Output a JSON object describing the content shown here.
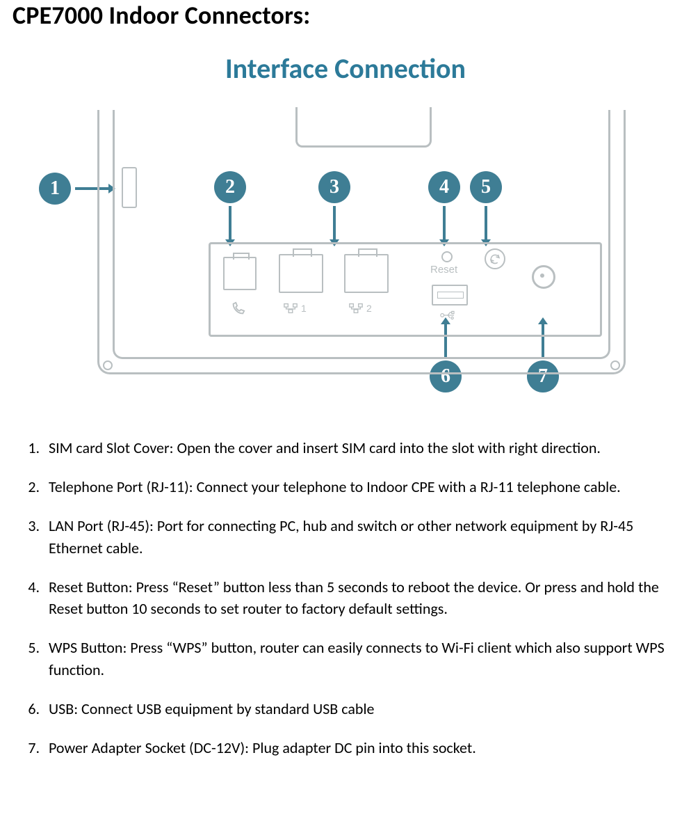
{
  "title": "CPE7000 Indoor Connectors:",
  "subtitle": "Interface Connection",
  "callouts": {
    "c1": "1",
    "c2": "2",
    "c3": "3",
    "c4": "4",
    "c5": "5",
    "c6": "6",
    "c7": "7"
  },
  "panel": {
    "reset_label": "Reset",
    "lan1_label": "1",
    "lan2_label": "2"
  },
  "list": {
    "i1": "SIM card Slot Cover: Open the cover and insert SIM card into the slot with right direction.",
    "i2": "Telephone Port (RJ-11): Connect your telephone to Indoor CPE with a RJ-11 telephone cable.",
    "i3": "LAN Port (RJ-45): Port for connecting PC, hub and switch or other network equipment by RJ-45 Ethernet cable.",
    "i4": "Reset Button: Press “Reset” button less than 5 seconds to reboot the device. Or press and hold the Reset button 10 seconds to set router to factory default settings.",
    "i5": "WPS Button: Press “WPS” button, router can easily connects to Wi-Fi client which also support WPS function.",
    "i6": "USB: Connect USB equipment by standard USB cable",
    "i7": "Power Adapter Socket (DC-12V): Plug adapter DC pin into this socket."
  }
}
